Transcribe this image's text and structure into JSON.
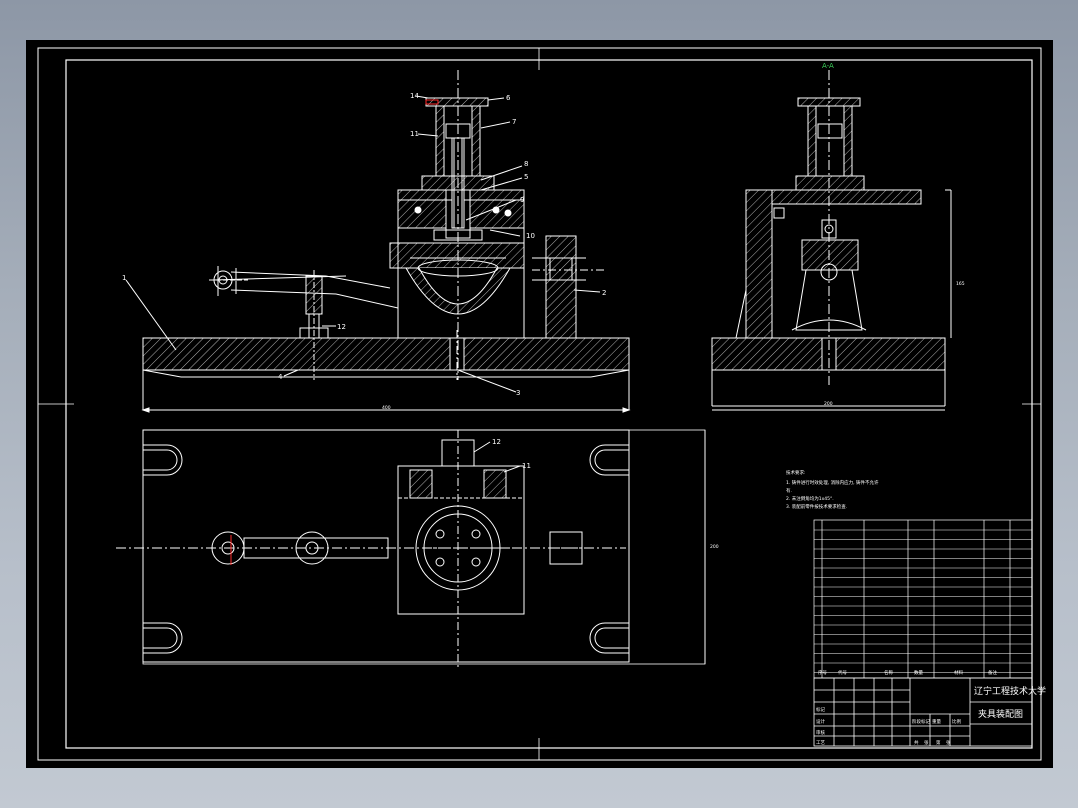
{
  "drawing": {
    "section_label": "A-A",
    "callouts": {
      "front": [
        "14",
        "6",
        "11",
        "7",
        "9",
        "8",
        "5",
        "10",
        "1",
        "12",
        "4",
        "3",
        "2"
      ],
      "plan": [
        "12",
        "11"
      ]
    },
    "dimensions": {
      "front_width": "400",
      "side_width": "200",
      "side_height": "165",
      "plan_height": "200"
    },
    "notes": {
      "title": "技术要求:",
      "items": [
        "1. 铸件进行时效处理, 消除内应力, 铸件不允许",
        "   有.",
        "2. 未注倒角均为1x45°.",
        "3. 装配前零件按技术要求检查."
      ]
    },
    "title_block": {
      "school": "辽宁工程技术大学",
      "drawing_name": "夹具装配图",
      "header": [
        "序号",
        "代号",
        "名称",
        "数量",
        "材料",
        "备注"
      ],
      "sign_rows": [
        "标记",
        "设计",
        "审核",
        "工艺"
      ],
      "stage_labels": [
        "阶段标记",
        "重量",
        "比例"
      ],
      "sheet_labels": [
        "共",
        "张",
        "第",
        "张"
      ]
    },
    "colors": {
      "background": "#000000",
      "lines": "#ffffff",
      "accent_red": "#ff2a2a",
      "accent_green": "#3ccf5a"
    }
  }
}
